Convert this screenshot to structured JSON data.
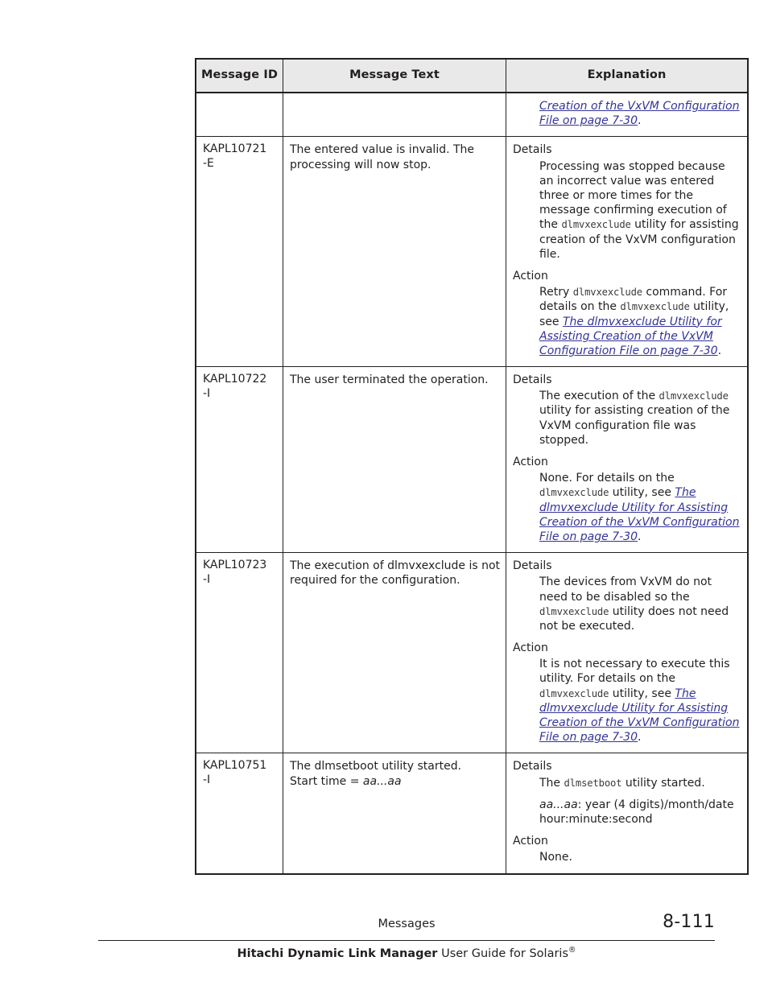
{
  "document": {
    "table": {
      "headers": [
        "Message\nID",
        "Message Text",
        "Explanation"
      ],
      "continued_row": {
        "explanation_fragment_link": "Creation of the VxVM Configuration File on page 7-30",
        "explanation_fragment_tail": "."
      },
      "rows": [
        {
          "id": "KAPL10721\n-E",
          "message_text_lines": [
            "The entered value is invalid. The processing will now stop."
          ],
          "details_label": "Details",
          "details_parts": [
            {
              "t": "text",
              "v": "Processing was stopped because an incorrect value was entered three or more times for the message confirming execution of the "
            },
            {
              "t": "mono",
              "v": "dlmvxexclude"
            },
            {
              "t": "text",
              "v": " utility for assisting creation of the VxVM configuration file."
            }
          ],
          "action_label": "Action",
          "action_parts": [
            {
              "t": "text",
              "v": "Retry "
            },
            {
              "t": "mono",
              "v": "dlmvxexclude"
            },
            {
              "t": "text",
              "v": " command. For details on the "
            },
            {
              "t": "mono",
              "v": "dlmvxexclude"
            },
            {
              "t": "text",
              "v": " utility, see "
            },
            {
              "t": "link",
              "v": "The dlmvxexclude Utility for Assisting Creation of the VxVM Configuration File on page 7-30"
            },
            {
              "t": "text",
              "v": "."
            }
          ]
        },
        {
          "id": "KAPL10722\n-I",
          "message_text_lines": [
            "The user terminated the operation."
          ],
          "details_label": "Details",
          "details_parts": [
            {
              "t": "text",
              "v": "The execution of the "
            },
            {
              "t": "mono",
              "v": "dlmvxexclude"
            },
            {
              "t": "text",
              "v": " utility for assisting creation of the VxVM configuration file was stopped."
            }
          ],
          "action_label": "Action",
          "action_parts": [
            {
              "t": "text",
              "v": "None. For details on the "
            },
            {
              "t": "mono",
              "v": "dlmvxexclude"
            },
            {
              "t": "text",
              "v": " utility, see "
            },
            {
              "t": "link",
              "v": "The dlmvxexclude Utility for Assisting Creation of the VxVM Configuration File on page 7-30"
            },
            {
              "t": "text",
              "v": "."
            }
          ]
        },
        {
          "id": "KAPL10723\n-I",
          "message_text_lines": [
            "The execution of dlmvxexclude is not required for the configuration."
          ],
          "details_label": "Details",
          "details_parts": [
            {
              "t": "text",
              "v": "The devices from VxVM do not need to be disabled so the "
            },
            {
              "t": "mono",
              "v": "dlmvxexclude"
            },
            {
              "t": "text",
              "v": " utility does not need not be executed."
            }
          ],
          "action_label": "Action",
          "action_parts": [
            {
              "t": "text",
              "v": "It is not necessary to execute this utility. For details on the "
            },
            {
              "t": "mono",
              "v": "dlmvxexclude"
            },
            {
              "t": "text",
              "v": " utility, see "
            },
            {
              "t": "link",
              "v": "The dlmvxexclude Utility for Assisting Creation of the VxVM Configuration File on page 7-30"
            },
            {
              "t": "text",
              "v": "."
            }
          ]
        },
        {
          "id": "KAPL10751\n-I",
          "message_text_parts": [
            {
              "t": "text",
              "v": "The dlmsetboot utility started."
            },
            {
              "t": "br",
              "v": ""
            },
            {
              "t": "text",
              "v": "Start time = "
            },
            {
              "t": "ital",
              "v": "aa...aa"
            }
          ],
          "details_label": "Details",
          "details_parts": [
            {
              "t": "text",
              "v": "The "
            },
            {
              "t": "mono",
              "v": "dlmsetboot"
            },
            {
              "t": "text",
              "v": " utility started."
            }
          ],
          "details_parts2": [
            {
              "t": "ital",
              "v": "aa...aa"
            },
            {
              "t": "text",
              "v": ": year (4 digits)/month/date hour:minute:second"
            }
          ],
          "action_label": "Action",
          "action_parts": [
            {
              "t": "text",
              "v": "None."
            }
          ]
        }
      ]
    },
    "footer": {
      "chapter": "Messages",
      "page_number": "8-111",
      "book_title_bold": "Hitachi Dynamic Link Manager",
      "book_title_rest": " User Guide for Solaris",
      "book_title_sup": "®"
    }
  },
  "colors": {
    "link": "#33339a",
    "header_bg": "#e9e9e9",
    "border": "#231f20",
    "text": "#231f20"
  }
}
